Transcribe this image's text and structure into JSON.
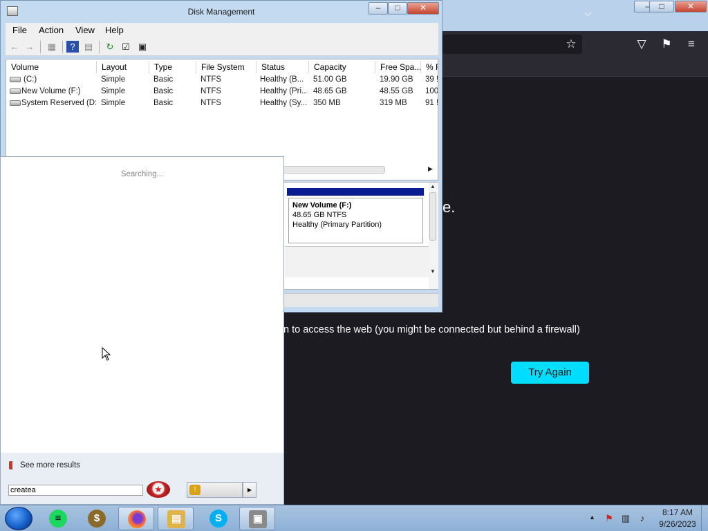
{
  "firefox": {
    "error_text": "n to access the web (you might be connected but behind a firewall)",
    "error_fragment": "e.",
    "try_again_label": "Try Again",
    "chevron": "⌵",
    "window_controls": {
      "minimize": "–",
      "maximize": "□",
      "close": "✕"
    },
    "toolbar_icons": {
      "bookmark_star": "☆",
      "pocket": "▽",
      "extensions": "⚑",
      "menu": "≡"
    }
  },
  "disk_management": {
    "title": "Disk Management",
    "window_controls": {
      "minimize": "–",
      "maximize": "□",
      "close": "✕"
    },
    "menu": [
      "File",
      "Action",
      "View",
      "Help"
    ],
    "toolbar_icons": [
      "←",
      "→",
      "▦",
      "?",
      "▤",
      "↻",
      "☑",
      "▣"
    ],
    "columns": [
      "Volume",
      "Layout",
      "Type",
      "File System",
      "Status",
      "Capacity",
      "Free Spa...",
      "% F"
    ],
    "volumes": [
      {
        "volume": "(C:)",
        "layout": "Simple",
        "type": "Basic",
        "fs": "NTFS",
        "status": "Healthy (B...",
        "capacity": "51.00 GB",
        "free": "19.90 GB",
        "pct": "39 !"
      },
      {
        "volume": "New Volume (F:)",
        "layout": "Simple",
        "type": "Basic",
        "fs": "NTFS",
        "status": "Healthy (Pri...",
        "capacity": "48.65 GB",
        "free": "48.55 GB",
        "pct": "100"
      },
      {
        "volume": "System Reserved (D:)",
        "layout": "Simple",
        "type": "Basic",
        "fs": "NTFS",
        "status": "Healthy (Sy...",
        "capacity": "350 MB",
        "free": "319 MB",
        "pct": "91 !"
      }
    ],
    "graph_volume": {
      "name": "New Volume  (F:)",
      "size_fs": "48.65 GB NTFS",
      "health": "Healthy (Primary Partition)"
    }
  },
  "start_menu": {
    "searching_text": "Searching...",
    "see_more_label": "See more results",
    "search_value": "createa"
  },
  "taskbar": {
    "clock_time": "8:17 AM",
    "clock_date": "9/26/2023",
    "apps": [
      {
        "name": "spotify",
        "glyph": "≡",
        "color": "#1ed760"
      },
      {
        "name": "money-app",
        "glyph": "$",
        "color": "#8a6a2a"
      },
      {
        "name": "firefox",
        "glyph": "●",
        "color": "#ff7139"
      },
      {
        "name": "file-explorer",
        "glyph": "▤",
        "color": "#e0b24a"
      },
      {
        "name": "skype",
        "glyph": "S",
        "color": "#00aff0"
      },
      {
        "name": "disk-management",
        "glyph": "▣",
        "color": "#8a8a8a"
      }
    ],
    "tray_icons": {
      "overflow": "▲",
      "action_center": "⚑",
      "network": "▥",
      "volume": "♪"
    }
  }
}
